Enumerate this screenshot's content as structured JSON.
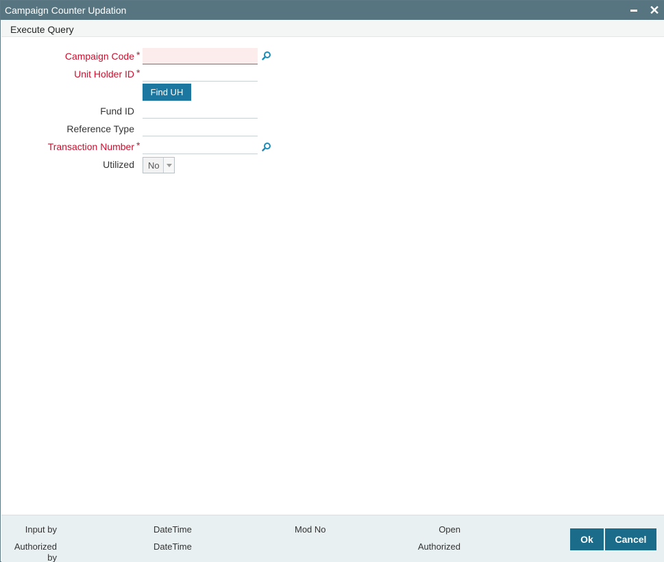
{
  "window": {
    "title": "Campaign Counter Updation"
  },
  "menu": {
    "execute_query": "Execute Query"
  },
  "form": {
    "campaign_code_label": "Campaign Code",
    "campaign_code_value": "",
    "unit_holder_id_label": "Unit Holder ID",
    "unit_holder_id_value": "",
    "find_uh_label": "Find UH",
    "fund_id_label": "Fund ID",
    "fund_id_value": "",
    "reference_type_label": "Reference Type",
    "reference_type_value": "",
    "transaction_number_label": "Transaction Number",
    "transaction_number_value": "",
    "utilized_label": "Utilized",
    "utilized_value": "No",
    "required_marker": "*"
  },
  "footer": {
    "input_by": "Input by",
    "authorized_by": "Authorized by",
    "datetime_1": "DateTime",
    "datetime_2": "DateTime",
    "mod_no": "Mod No",
    "open": "Open",
    "authorized": "Authorized",
    "ok_label": "Ok",
    "cancel_label": "Cancel"
  },
  "colors": {
    "titlebar": "#577580",
    "required_label": "#c8102e",
    "primary_button": "#1b77a0",
    "footer_button": "#1b6c8a",
    "footer_bg": "#e8f0f2"
  },
  "icons": [
    "minimize-icon",
    "close-icon",
    "search-icon",
    "chevron-down-icon"
  ]
}
